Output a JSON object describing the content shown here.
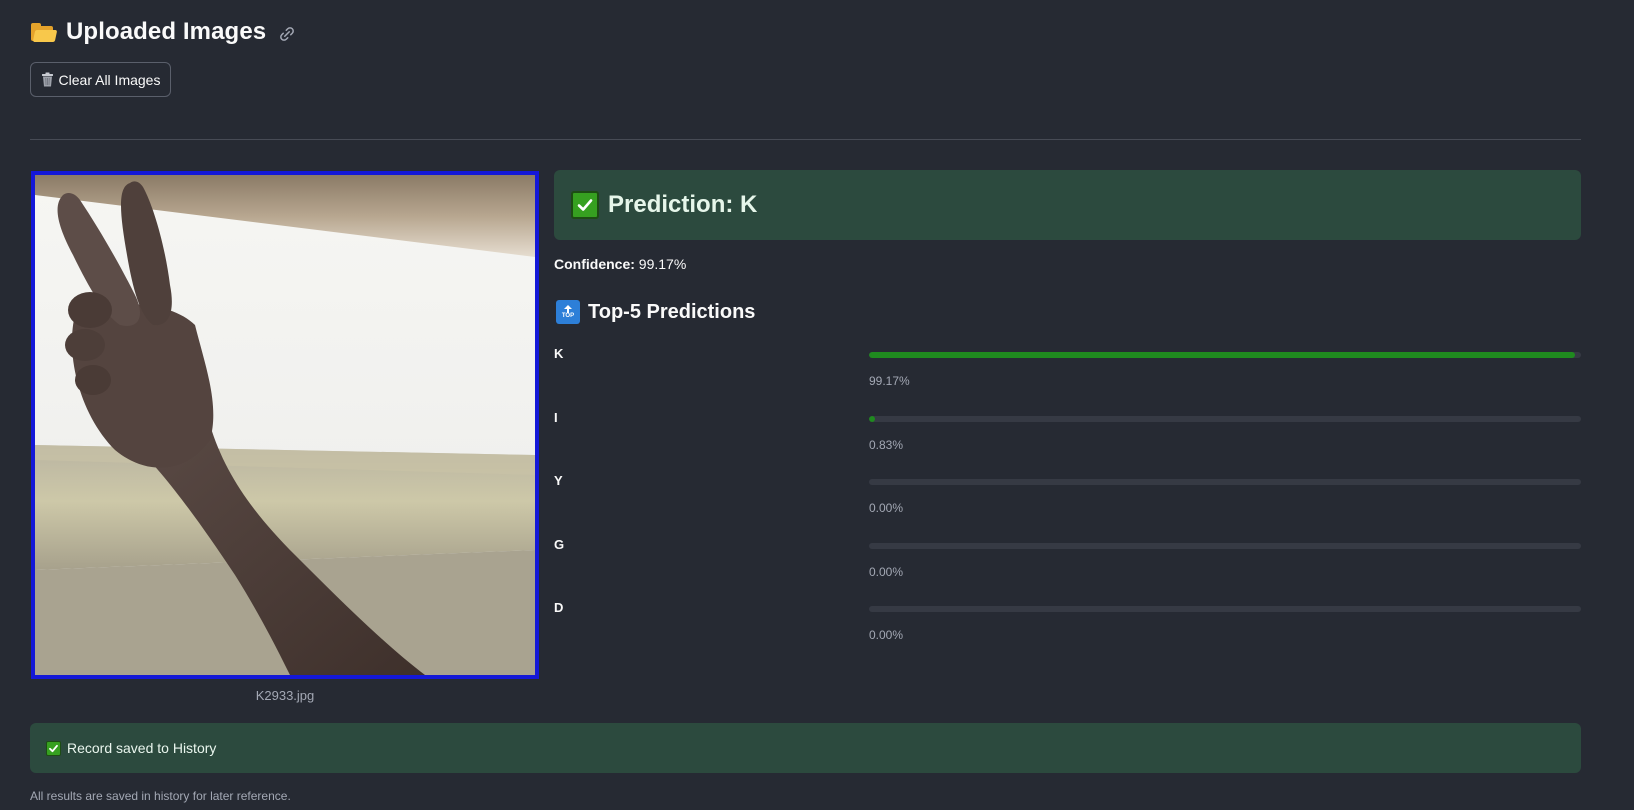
{
  "header": {
    "title": "Uploaded Images",
    "icon": "folder-icon",
    "link_icon": "link-icon"
  },
  "toolbar": {
    "clear_label": "Clear All Images",
    "clear_icon": "trash-icon"
  },
  "image": {
    "filename": "K2933.jpg",
    "border_color": "#1418d8"
  },
  "prediction": {
    "text": "Prediction: K",
    "confidence_label": "Confidence:",
    "confidence_value": "99.17%",
    "box_color": "#2c4a3e"
  },
  "top5": {
    "title": "Top-5 Predictions",
    "icon": "top-arrow-icon",
    "bar_color": "#1f8a1f",
    "items": [
      {
        "label": "K",
        "percent": "99.17%",
        "value": 0.9917
      },
      {
        "label": "I",
        "percent": "0.83%",
        "value": 0.0083
      },
      {
        "label": "Y",
        "percent": "0.00%",
        "value": 0.0
      },
      {
        "label": "G",
        "percent": "0.00%",
        "value": 0.0
      },
      {
        "label": "D",
        "percent": "0.00%",
        "value": 0.0
      }
    ]
  },
  "status": {
    "saved_text": "Record saved to History",
    "footnote": "All results are saved in history for later reference."
  }
}
